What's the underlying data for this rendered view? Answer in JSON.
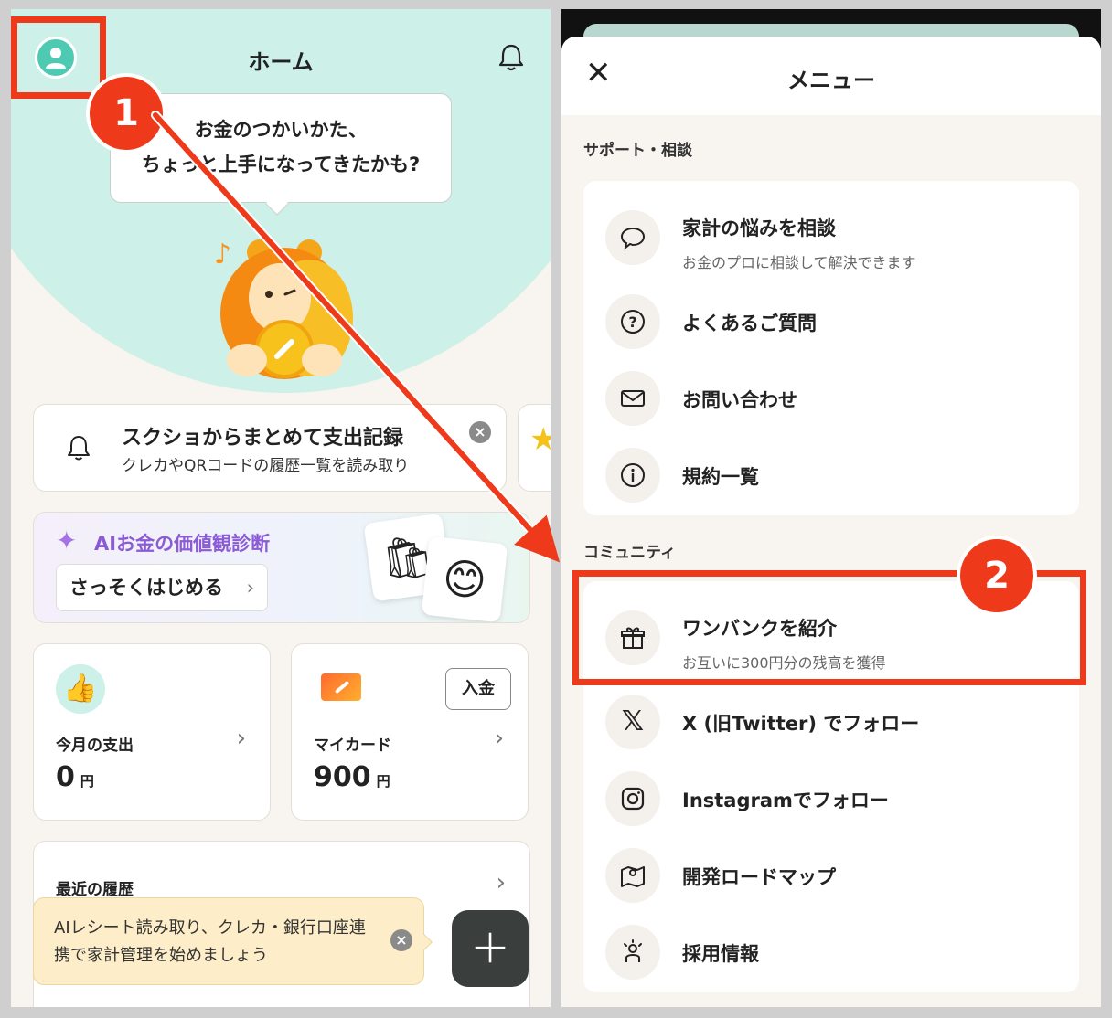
{
  "left": {
    "header": {
      "title": "ホーム"
    },
    "bubble": {
      "line1": "お金のつかいかた、",
      "line2": "ちょっと上手になってきたかも?"
    },
    "notice": {
      "title": "スクショからまとめて支出記録",
      "subtitle": "クレカやQRコードの履歴一覧を読み取り"
    },
    "ai": {
      "title": "AIお金の価値観診断",
      "button": "さっそくはじめる"
    },
    "stats": [
      {
        "label": "今月の支出",
        "value": "0",
        "unit": "円"
      },
      {
        "label": "マイカード",
        "value": "900",
        "unit": "円",
        "button": "入金"
      }
    ],
    "history": {
      "title": "最近の履歴"
    },
    "toast": {
      "text": "AIレシート読み取り、クレカ・銀行口座連携で家計管理を始めましょう"
    }
  },
  "right": {
    "header": {
      "title": "メニュー"
    },
    "sections": [
      {
        "title": "サポート・相談",
        "items": [
          {
            "title": "家計の悩みを相談",
            "subtitle": "お金のプロに相談して解決できます"
          },
          {
            "title": "よくあるご質問"
          },
          {
            "title": "お問い合わせ"
          },
          {
            "title": "規約一覧"
          }
        ]
      },
      {
        "title": "コミュニティ",
        "items": [
          {
            "title": "ワンバンクを紹介",
            "subtitle": "お互いに300円分の残高を獲得"
          },
          {
            "title": "X (旧Twitter) でフォロー"
          },
          {
            "title": "Instagramでフォロー"
          },
          {
            "title": "開発ロードマップ"
          },
          {
            "title": "採用情報"
          }
        ]
      }
    ]
  },
  "annotations": {
    "step1": "1",
    "step2": "2",
    "color": "#ee3a1a"
  },
  "icons": {
    "avatar": "user-avatar-icon",
    "bell": "bell-icon",
    "chat": "chat-bubble-icon",
    "question": "question-circle-icon",
    "mail": "mail-icon",
    "info": "info-circle-icon",
    "gift": "gift-icon",
    "x": "x-logo-icon",
    "instagram": "instagram-icon",
    "map": "map-icon",
    "recruit": "person-sparkle-icon"
  }
}
